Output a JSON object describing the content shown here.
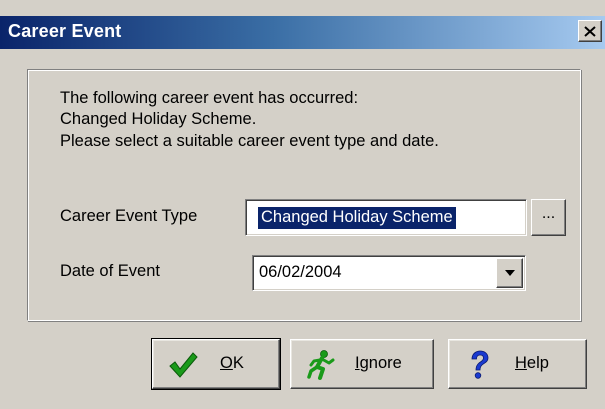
{
  "window": {
    "title": "Career Event"
  },
  "message": {
    "line1": "The following career event has occurred:",
    "line2": "Changed Holiday Scheme.",
    "line3": "Please select a suitable career event type and date."
  },
  "form": {
    "event_type_label": "Career Event Type",
    "event_type_value": "Changed Holiday Scheme",
    "browse_label": "...",
    "date_label": "Date of Event",
    "date_value": "06/02/2004"
  },
  "buttons": {
    "ok": {
      "mnemonic": "O",
      "rest": "K",
      "icon": "checkmark-icon"
    },
    "ignore": {
      "mnemonic": "I",
      "rest": "gnore",
      "icon": "running-man-icon"
    },
    "help": {
      "mnemonic": "H",
      "rest": "elp",
      "icon": "question-mark-icon"
    }
  },
  "colors": {
    "titlebar_start": "#0a246a",
    "titlebar_end": "#a6caf0",
    "dialog_bg": "#d4d0c8",
    "selection_bg": "#0a246a",
    "check_green": "#1a9a1a",
    "help_blue": "#1a3ad0"
  }
}
